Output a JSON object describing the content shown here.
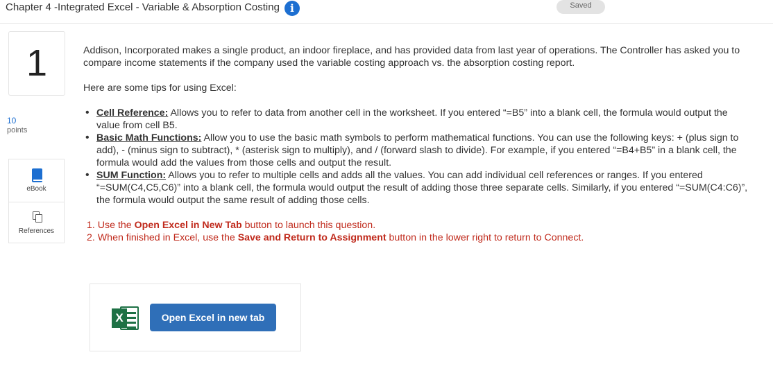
{
  "header": {
    "title": "Chapter 4 -Integrated Excel - Variable & Absorption Costing",
    "info_icon": "i",
    "saved_label": "Saved"
  },
  "question": {
    "number": "1",
    "points_value": "10",
    "points_label": "points"
  },
  "tools": {
    "ebook_label": "eBook",
    "references_label": "References"
  },
  "content": {
    "intro": "Addison, Incorporated makes a single product, an indoor fireplace, and has provided data from last year of operations. The Controller has asked you to compare income statements if the company used the variable costing approach vs. the absorption costing report.",
    "tips_intro": "Here are some tips for using Excel:",
    "tips": [
      {
        "term": "Cell Reference:",
        "text": " Allows you to refer to data from another cell in the worksheet. If you entered “=B5” into a blank cell, the formula would output the value from cell B5."
      },
      {
        "term": "Basic Math Functions:",
        "text": " Allow you to use the basic math symbols to perform mathematical functions. You can use the following keys: + (plus sign to add), - (minus sign to subtract), * (asterisk sign to multiply), and / (forward slash to divide). For example, if you entered “=B4+B5” in a blank cell, the formula would add the values from those cells and output the result."
      },
      {
        "term": "SUM Function:",
        "text": " Allows you to refer to multiple cells and adds all the values. You can add individual cell references or ranges. If you entered “=SUM(C4,C5,C6)” into a blank cell, the formula would output the result of adding those three separate cells. Similarly, if you entered “=SUM(C4:C6)”, the formula would output the same result of adding those cells."
      }
    ],
    "step1": {
      "num": "1.",
      "pre": " Use the ",
      "bold": "Open Excel in New Tab",
      "post": " button to launch this question."
    },
    "step2": {
      "num": "2.",
      "pre": " When finished in Excel, use the ",
      "bold": "Save and Return to Assignment",
      "post": " button in the lower right to return to Connect."
    }
  },
  "excel": {
    "icon_letter": "X",
    "button_label": "Open Excel in new tab"
  },
  "colors": {
    "accent": "#1d6fd1",
    "button": "#2f6fb8",
    "instructions": "#c02a1c",
    "excel_green": "#1e7145"
  }
}
